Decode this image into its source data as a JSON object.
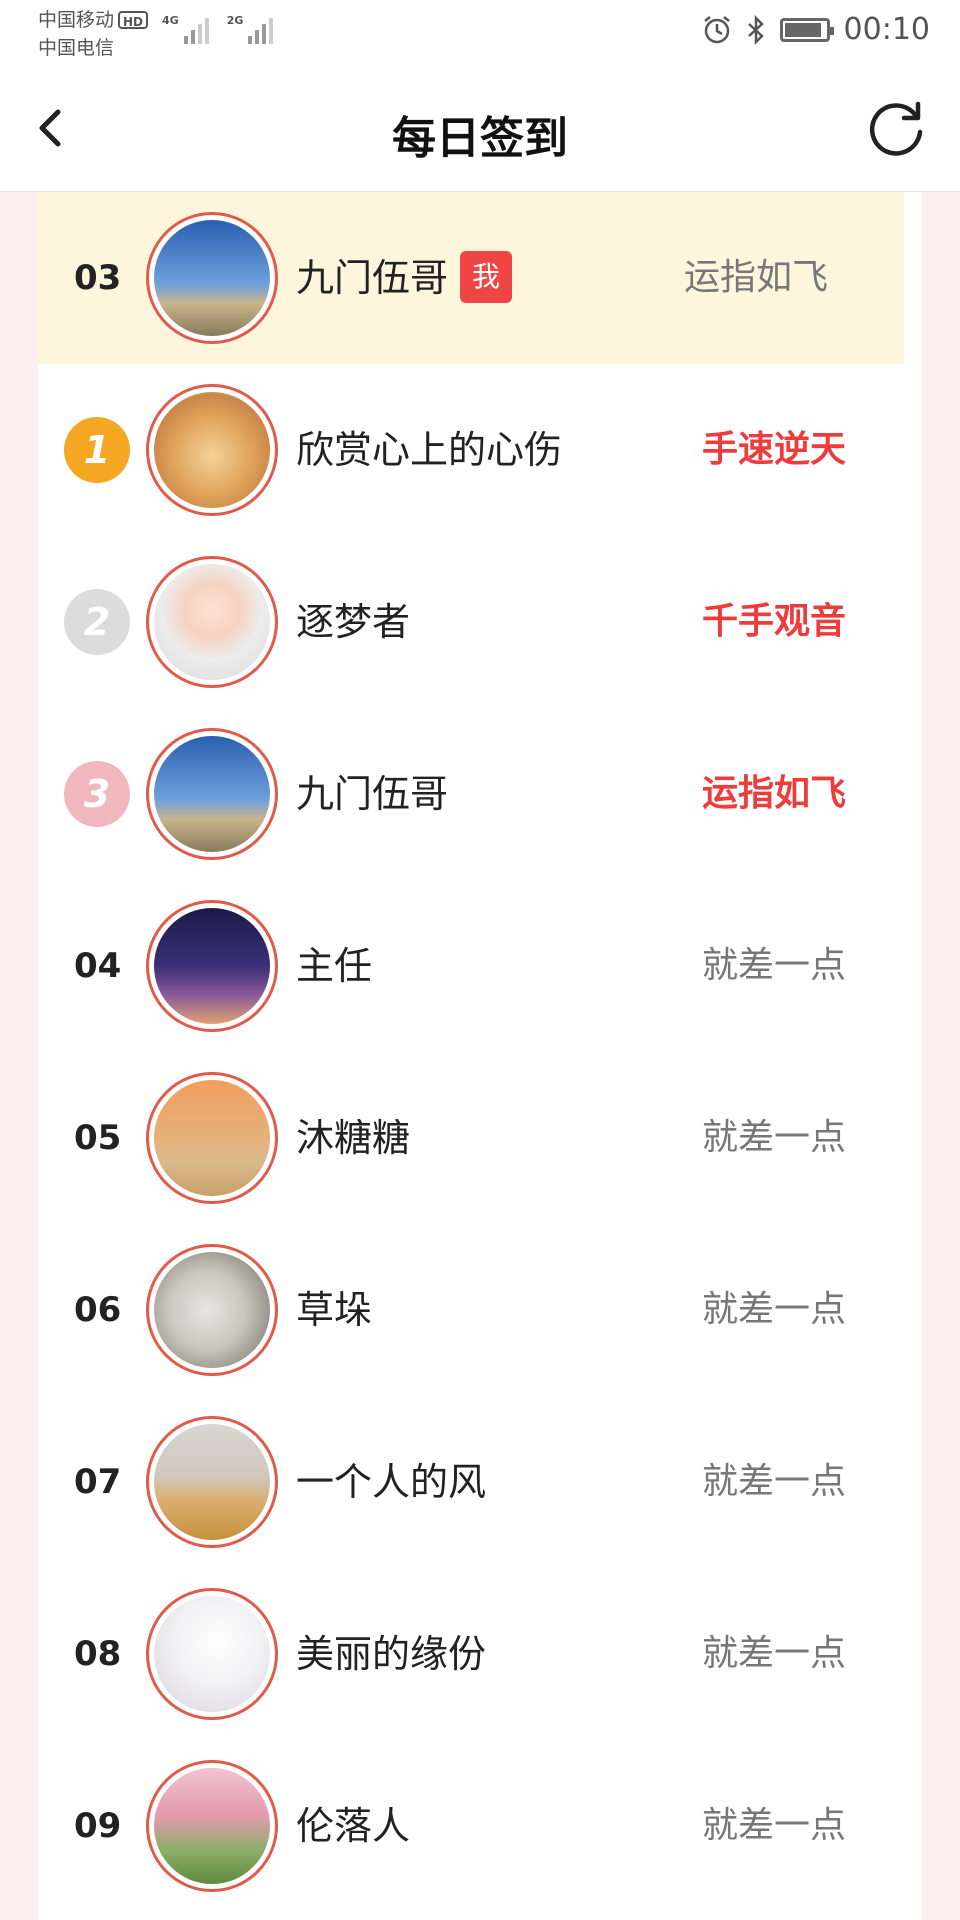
{
  "status_bar": {
    "carrier1": "中国移动",
    "hd": "HD",
    "carrier2": "中国电信",
    "net1": "4G",
    "net2": "2G",
    "time": "00:10",
    "battery_level": 0.9
  },
  "header": {
    "title": "每日签到",
    "back_icon": "chevron-left-icon",
    "refresh_icon": "refresh-icon"
  },
  "my_row": {
    "rank": "03",
    "name": "九门伍哥",
    "badge": "我",
    "status": "运指如飞"
  },
  "top_rows": [
    {
      "medal": "1",
      "name": "欣赏心上的心伤",
      "status": "手速逆天"
    },
    {
      "medal": "2",
      "name": "逐梦者",
      "status": "千手观音"
    },
    {
      "medal": "3",
      "name": "九门伍哥",
      "status": "运指如飞"
    }
  ],
  "rows": [
    {
      "rank": "04",
      "name": "主任",
      "status": "就差一点"
    },
    {
      "rank": "05",
      "name": "沐糖糖",
      "status": "就差一点"
    },
    {
      "rank": "06",
      "name": "草垛",
      "status": "就差一点"
    },
    {
      "rank": "07",
      "name": "一个人的风",
      "status": "就差一点"
    },
    {
      "rank": "08",
      "name": "美丽的缘份",
      "status": "就差一点"
    },
    {
      "rank": "09",
      "name": "伦落人",
      "status": "就差一点"
    }
  ],
  "colors": {
    "accent_red": "#ee3b3b",
    "highlight_bg": "#fdf5dc",
    "side_bg": "#fdeff0",
    "avatar_border": "#e25a4a"
  }
}
